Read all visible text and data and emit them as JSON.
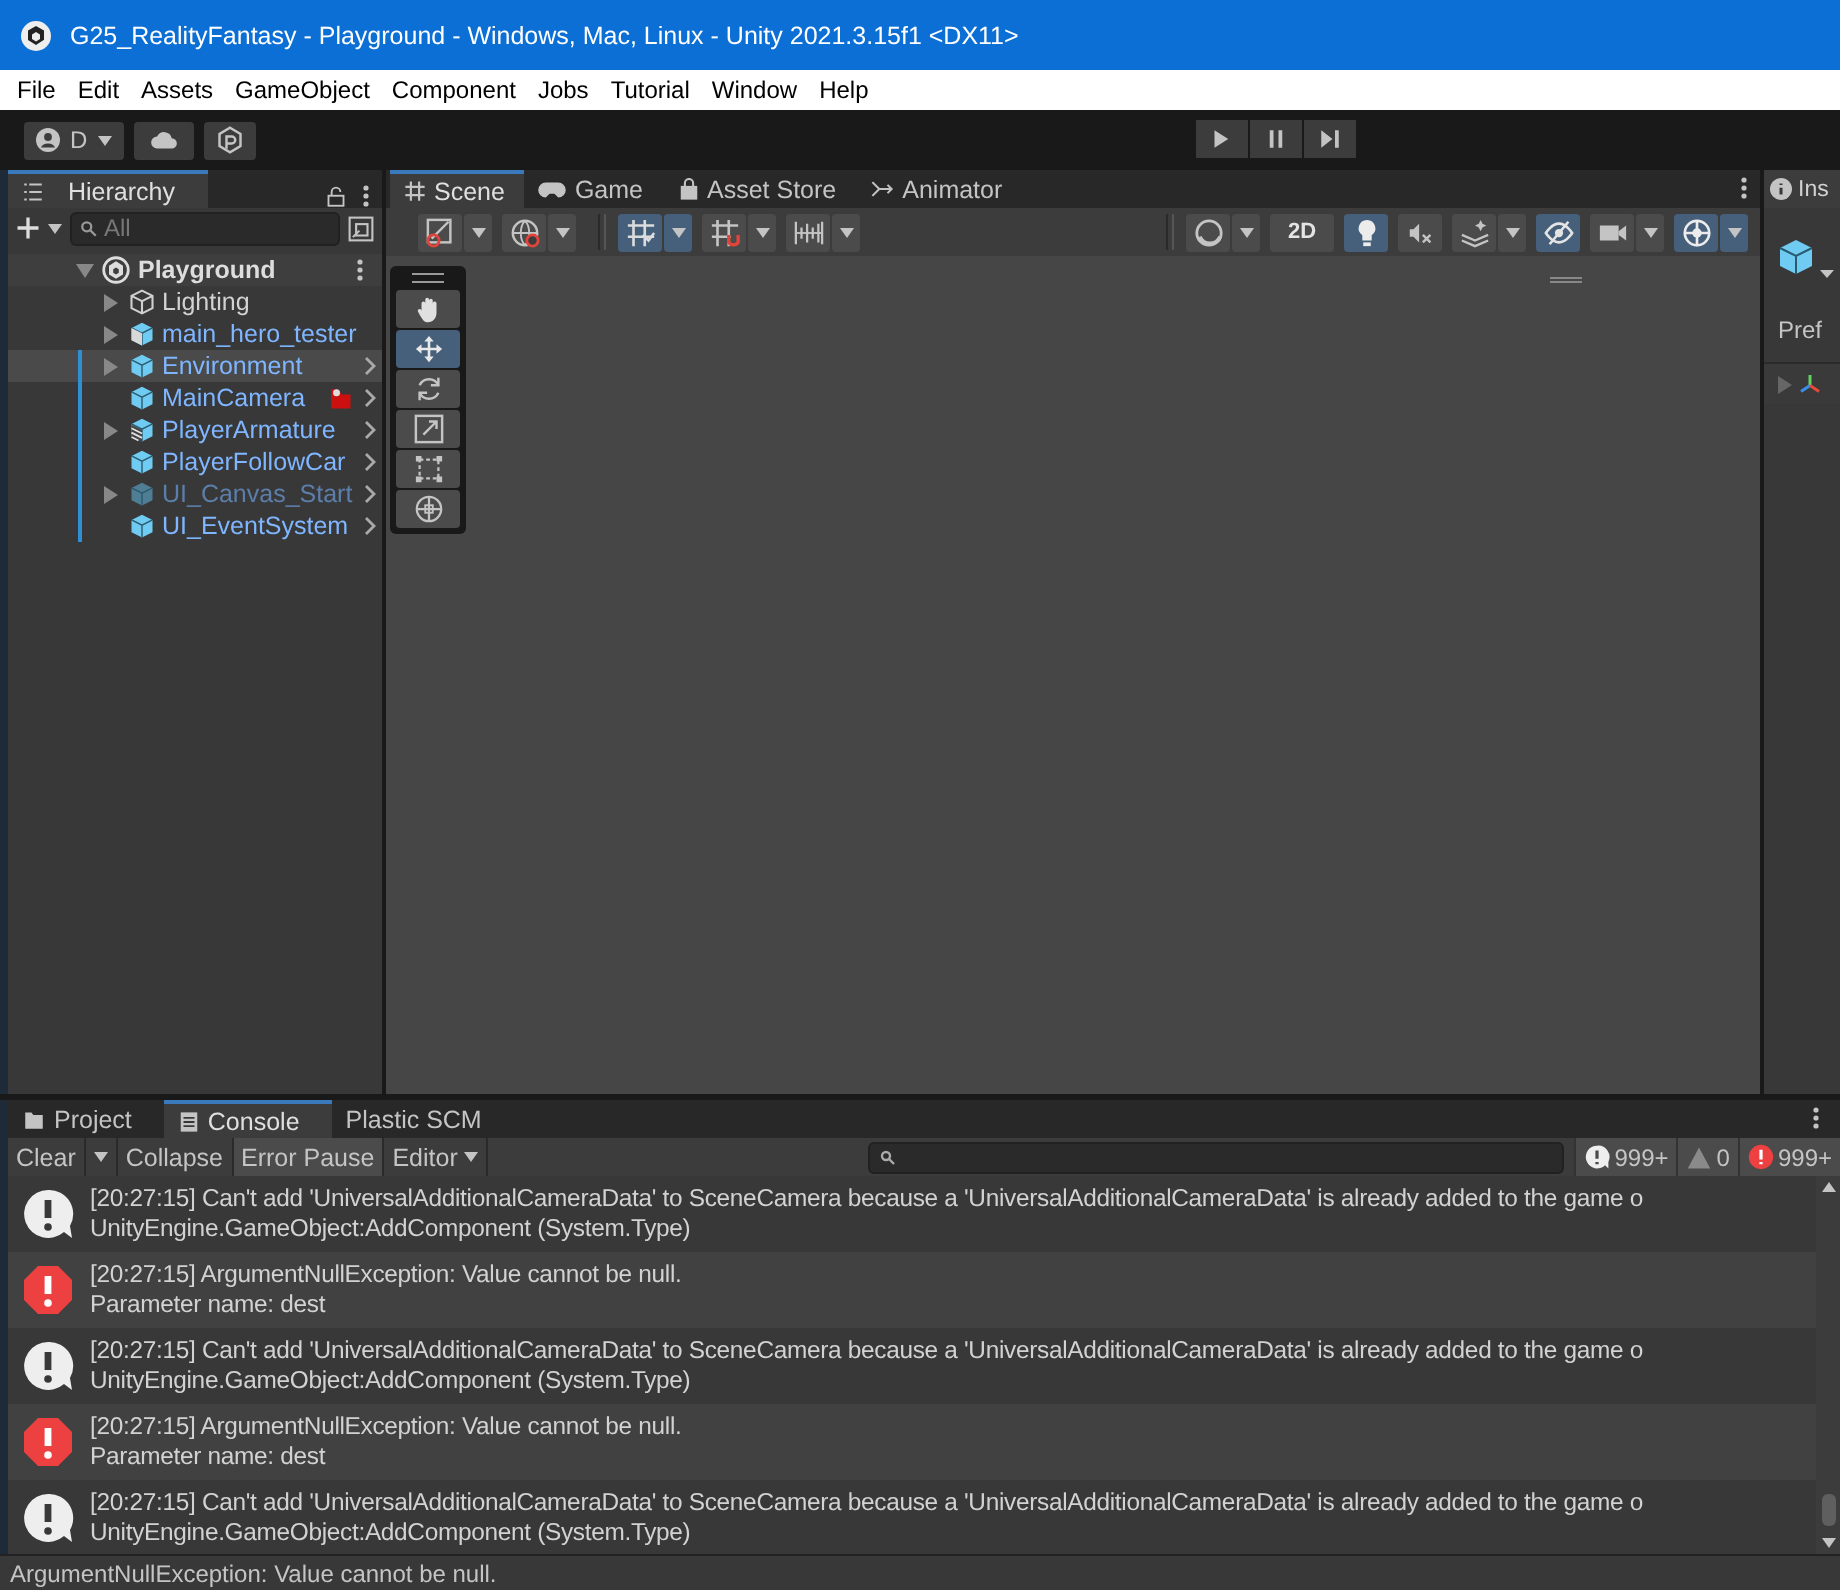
{
  "window": {
    "title": "G25_RealityFantasy - Playground - Windows, Mac, Linux - Unity 2021.3.15f1 <DX11>"
  },
  "menu": [
    "File",
    "Edit",
    "Assets",
    "GameObject",
    "Component",
    "Jobs",
    "Tutorial",
    "Window",
    "Help"
  ],
  "toolbar": {
    "account": "D"
  },
  "hierarchy": {
    "tab": "Hierarchy",
    "search": {
      "placeholder": "All"
    },
    "scene": "Playground",
    "items": [
      {
        "name": "Lighting",
        "kind": "object",
        "expandable": true,
        "chevron": false,
        "modified": false,
        "badge": false,
        "active": true,
        "selected": false
      },
      {
        "name": "main_hero_tester",
        "kind": "model",
        "expandable": true,
        "chevron": false,
        "modified": false,
        "badge": false,
        "active": true,
        "selected": false
      },
      {
        "name": "Environment",
        "kind": "prefab",
        "expandable": true,
        "chevron": true,
        "modified": true,
        "badge": false,
        "active": true,
        "selected": true
      },
      {
        "name": "MainCamera",
        "kind": "prefab",
        "expandable": false,
        "chevron": true,
        "modified": true,
        "badge": true,
        "active": true,
        "selected": false
      },
      {
        "name": "PlayerArmature",
        "kind": "variant",
        "expandable": true,
        "chevron": true,
        "modified": true,
        "badge": false,
        "active": true,
        "selected": false
      },
      {
        "name": "PlayerFollowCar",
        "kind": "prefab",
        "expandable": false,
        "chevron": true,
        "modified": true,
        "badge": false,
        "active": true,
        "selected": false
      },
      {
        "name": "UI_Canvas_Start",
        "kind": "prefab",
        "expandable": true,
        "chevron": true,
        "modified": true,
        "badge": false,
        "active": false,
        "selected": false
      },
      {
        "name": "UI_EventSystem",
        "kind": "prefab",
        "expandable": false,
        "chevron": true,
        "modified": true,
        "badge": false,
        "active": true,
        "selected": false
      }
    ]
  },
  "scene_tabs": [
    {
      "label": "Scene",
      "selected": true
    },
    {
      "label": "Game",
      "selected": false
    },
    {
      "label": "Asset Store",
      "selected": false
    },
    {
      "label": "Animator",
      "selected": false
    }
  ],
  "scene_toolbar": [
    {
      "on": false
    },
    {
      "on": false
    },
    {
      "on": true
    },
    {
      "on": false
    },
    {
      "on": false
    },
    {
      "on": false
    },
    {
      "label": "2D",
      "on": false
    },
    {
      "on": true
    },
    {
      "on": false
    },
    {
      "on": false
    },
    {
      "on": true
    },
    {
      "on": false
    },
    {
      "on": true
    }
  ],
  "tools": [
    {
      "selected": false
    },
    {
      "selected": true
    },
    {
      "selected": false
    },
    {
      "selected": false
    },
    {
      "selected": false
    },
    {
      "selected": false
    }
  ],
  "inspector": {
    "tab": "Ins",
    "label": "Pref"
  },
  "console": {
    "tabs": [
      {
        "label": "Project",
        "selected": false
      },
      {
        "label": "Console",
        "selected": true
      },
      {
        "label": "Plastic SCM",
        "selected": false
      }
    ],
    "buttons": [
      {
        "label": "Clear",
        "on": false
      },
      {
        "label": "Collapse",
        "on": false
      },
      {
        "label": "Error Pause",
        "on": true
      },
      {
        "label": "Editor",
        "on": false
      }
    ],
    "counts": {
      "logs": "999+",
      "warnings": "0",
      "errors": "999+"
    },
    "entries": [
      {
        "kind": "log",
        "text": "[20:27:15] Can't add 'UniversalAdditionalCameraData' to SceneCamera because a 'UniversalAdditionalCameraData' is already added to the game o",
        "detail": "UnityEngine.GameObject:AddComponent (System.Type)"
      },
      {
        "kind": "error",
        "text": "[20:27:15] ArgumentNullException: Value cannot be null.",
        "detail": "Parameter name: dest"
      },
      {
        "kind": "log",
        "text": "[20:27:15] Can't add 'UniversalAdditionalCameraData' to SceneCamera because a 'UniversalAdditionalCameraData' is already added to the game o",
        "detail": "UnityEngine.GameObject:AddComponent (System.Type)"
      },
      {
        "kind": "error",
        "text": "[20:27:15] ArgumentNullException: Value cannot be null.",
        "detail": "Parameter name: dest"
      },
      {
        "kind": "log",
        "text": "[20:27:15] Can't add 'UniversalAdditionalCameraData' to SceneCamera because a 'UniversalAdditionalCameraData' is already added to the game o",
        "detail": "UnityEngine.GameObject:AddComponent (System.Type)"
      }
    ]
  },
  "status_bar": {
    "text": "ArgumentNullException: Value cannot be null."
  }
}
